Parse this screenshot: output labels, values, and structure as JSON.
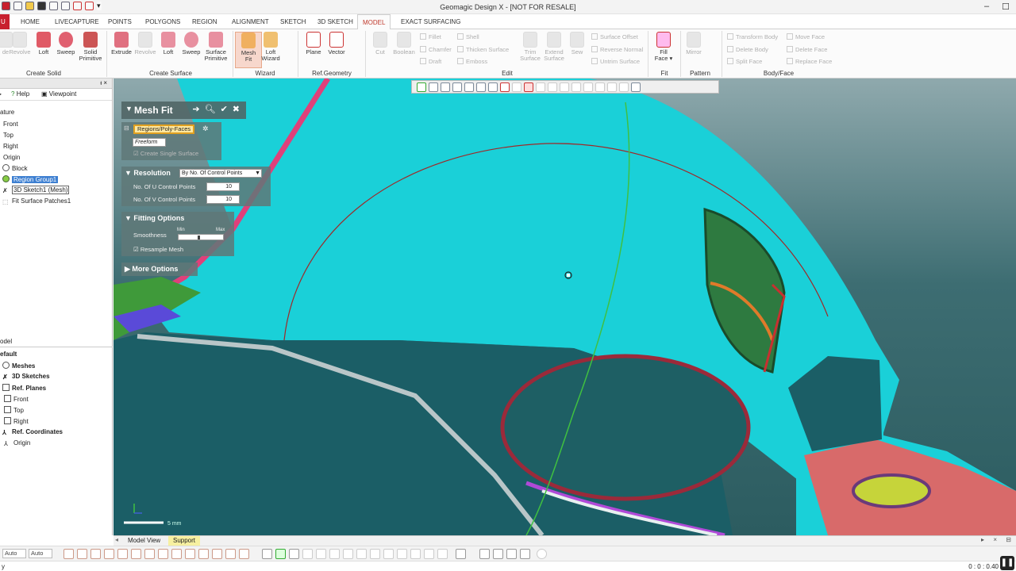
{
  "title": "Geomagic Design X - [NOT FOR RESALE]",
  "app_tab": "U",
  "tabs": [
    "HOME",
    "LIVECAPTURE",
    "POINTS",
    "POLYGONS",
    "REGION",
    "ALIGNMENT",
    "SKETCH",
    "3D SKETCH",
    "MODEL",
    "EXACT SURFACING"
  ],
  "ribbon": {
    "create_solid": {
      "label": "Create Solid",
      "items": [
        "de",
        "Revolve",
        "Loft",
        "Sweep",
        "Solid\nPrimitive"
      ]
    },
    "create_surface": {
      "label": "Create Surface",
      "items": [
        "Extrude",
        "Revolve",
        "Loft",
        "Sweep",
        "Surface\nPrimitive"
      ]
    },
    "wizard": {
      "label": "Wizard",
      "items": [
        "Mesh\nFit",
        "Loft\nWizard"
      ]
    },
    "ref_geometry": {
      "label": "Ref.Geometry",
      "items": [
        "Plane",
        "Vector"
      ]
    },
    "edit": {
      "label": "Edit",
      "items": [
        "Cut",
        "Boolean",
        "Fillet",
        "Chamfer",
        "Draft",
        "Shell",
        "Thicken Surface",
        "Emboss",
        "Trim\nSurface",
        "Extend\nSurface",
        "Sew",
        "Surface Offset",
        "Reverse Normal",
        "Untrim Surface"
      ]
    },
    "fit": {
      "label": "Fit",
      "items": [
        "Fill\nFace ▾"
      ]
    },
    "pattern": {
      "label": "Pattern",
      "items": [
        "Mirror"
      ]
    },
    "body_face": {
      "label": "Body/Face",
      "items": [
        "Transform Body",
        "Delete Body",
        "Split Face",
        "Move Face",
        "Delete Face",
        "Replace Face"
      ]
    }
  },
  "left_panel": {
    "pin": "ᵼ ×",
    "toolbar": {
      "help": "Help",
      "viewpoint": "Viewpoint"
    },
    "feature_header": "ature",
    "feature_items": [
      "Front",
      "Top",
      "Right",
      "Origin",
      "Block",
      "Region Group1",
      "3D Sketch1 (Mesh)",
      "Fit Surface Patches1"
    ],
    "model_header": "odel",
    "default_label": "efault",
    "model_items": [
      "Meshes",
      "3D Sketches",
      "Ref. Planes",
      "Front",
      "Top",
      "Right",
      "Ref. Coordinates",
      "Origin"
    ]
  },
  "mesh_fit": {
    "title": "Mesh Fit",
    "regions_label": "Regions/Poly-Faces",
    "freeform": "Freeform",
    "create_single": "Create Single Surface",
    "resolution_head": "Resolution",
    "resolution_mode": "By No. Of Control Points",
    "u_label": "No. Of U Control Points",
    "u_value": "10",
    "v_label": "No. Of V Control Points",
    "v_value": "10",
    "fitting_head": "Fitting Options",
    "smoothness": "Smoothness",
    "min": "Min",
    "max": "Max",
    "resample": "Resample Mesh",
    "more": "More Options"
  },
  "scale_text": "5 mm",
  "bottom_tabs": [
    "Model View",
    "Support"
  ],
  "toolbar2": {
    "auto1": "Auto",
    "auto2": "Auto"
  },
  "status": {
    "left": "y",
    "right": "0 : 0 : 0.40"
  },
  "colors": {
    "accent": "#c8202e",
    "mesh_cyan": "#1ad0d8",
    "selection": "#3d7fd1"
  }
}
